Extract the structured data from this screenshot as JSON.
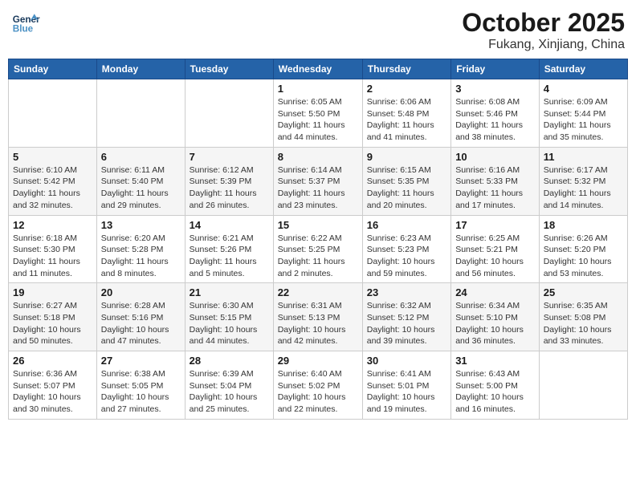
{
  "header": {
    "logo_line1": "General",
    "logo_line2": "Blue",
    "month": "October 2025",
    "location": "Fukang, Xinjiang, China"
  },
  "weekdays": [
    "Sunday",
    "Monday",
    "Tuesday",
    "Wednesday",
    "Thursday",
    "Friday",
    "Saturday"
  ],
  "weeks": [
    [
      {
        "day": "",
        "info": ""
      },
      {
        "day": "",
        "info": ""
      },
      {
        "day": "",
        "info": ""
      },
      {
        "day": "1",
        "info": "Sunrise: 6:05 AM\nSunset: 5:50 PM\nDaylight: 11 hours and 44 minutes."
      },
      {
        "day": "2",
        "info": "Sunrise: 6:06 AM\nSunset: 5:48 PM\nDaylight: 11 hours and 41 minutes."
      },
      {
        "day": "3",
        "info": "Sunrise: 6:08 AM\nSunset: 5:46 PM\nDaylight: 11 hours and 38 minutes."
      },
      {
        "day": "4",
        "info": "Sunrise: 6:09 AM\nSunset: 5:44 PM\nDaylight: 11 hours and 35 minutes."
      }
    ],
    [
      {
        "day": "5",
        "info": "Sunrise: 6:10 AM\nSunset: 5:42 PM\nDaylight: 11 hours and 32 minutes."
      },
      {
        "day": "6",
        "info": "Sunrise: 6:11 AM\nSunset: 5:40 PM\nDaylight: 11 hours and 29 minutes."
      },
      {
        "day": "7",
        "info": "Sunrise: 6:12 AM\nSunset: 5:39 PM\nDaylight: 11 hours and 26 minutes."
      },
      {
        "day": "8",
        "info": "Sunrise: 6:14 AM\nSunset: 5:37 PM\nDaylight: 11 hours and 23 minutes."
      },
      {
        "day": "9",
        "info": "Sunrise: 6:15 AM\nSunset: 5:35 PM\nDaylight: 11 hours and 20 minutes."
      },
      {
        "day": "10",
        "info": "Sunrise: 6:16 AM\nSunset: 5:33 PM\nDaylight: 11 hours and 17 minutes."
      },
      {
        "day": "11",
        "info": "Sunrise: 6:17 AM\nSunset: 5:32 PM\nDaylight: 11 hours and 14 minutes."
      }
    ],
    [
      {
        "day": "12",
        "info": "Sunrise: 6:18 AM\nSunset: 5:30 PM\nDaylight: 11 hours and 11 minutes."
      },
      {
        "day": "13",
        "info": "Sunrise: 6:20 AM\nSunset: 5:28 PM\nDaylight: 11 hours and 8 minutes."
      },
      {
        "day": "14",
        "info": "Sunrise: 6:21 AM\nSunset: 5:26 PM\nDaylight: 11 hours and 5 minutes."
      },
      {
        "day": "15",
        "info": "Sunrise: 6:22 AM\nSunset: 5:25 PM\nDaylight: 11 hours and 2 minutes."
      },
      {
        "day": "16",
        "info": "Sunrise: 6:23 AM\nSunset: 5:23 PM\nDaylight: 10 hours and 59 minutes."
      },
      {
        "day": "17",
        "info": "Sunrise: 6:25 AM\nSunset: 5:21 PM\nDaylight: 10 hours and 56 minutes."
      },
      {
        "day": "18",
        "info": "Sunrise: 6:26 AM\nSunset: 5:20 PM\nDaylight: 10 hours and 53 minutes."
      }
    ],
    [
      {
        "day": "19",
        "info": "Sunrise: 6:27 AM\nSunset: 5:18 PM\nDaylight: 10 hours and 50 minutes."
      },
      {
        "day": "20",
        "info": "Sunrise: 6:28 AM\nSunset: 5:16 PM\nDaylight: 10 hours and 47 minutes."
      },
      {
        "day": "21",
        "info": "Sunrise: 6:30 AM\nSunset: 5:15 PM\nDaylight: 10 hours and 44 minutes."
      },
      {
        "day": "22",
        "info": "Sunrise: 6:31 AM\nSunset: 5:13 PM\nDaylight: 10 hours and 42 minutes."
      },
      {
        "day": "23",
        "info": "Sunrise: 6:32 AM\nSunset: 5:12 PM\nDaylight: 10 hours and 39 minutes."
      },
      {
        "day": "24",
        "info": "Sunrise: 6:34 AM\nSunset: 5:10 PM\nDaylight: 10 hours and 36 minutes."
      },
      {
        "day": "25",
        "info": "Sunrise: 6:35 AM\nSunset: 5:08 PM\nDaylight: 10 hours and 33 minutes."
      }
    ],
    [
      {
        "day": "26",
        "info": "Sunrise: 6:36 AM\nSunset: 5:07 PM\nDaylight: 10 hours and 30 minutes."
      },
      {
        "day": "27",
        "info": "Sunrise: 6:38 AM\nSunset: 5:05 PM\nDaylight: 10 hours and 27 minutes."
      },
      {
        "day": "28",
        "info": "Sunrise: 6:39 AM\nSunset: 5:04 PM\nDaylight: 10 hours and 25 minutes."
      },
      {
        "day": "29",
        "info": "Sunrise: 6:40 AM\nSunset: 5:02 PM\nDaylight: 10 hours and 22 minutes."
      },
      {
        "day": "30",
        "info": "Sunrise: 6:41 AM\nSunset: 5:01 PM\nDaylight: 10 hours and 19 minutes."
      },
      {
        "day": "31",
        "info": "Sunrise: 6:43 AM\nSunset: 5:00 PM\nDaylight: 10 hours and 16 minutes."
      },
      {
        "day": "",
        "info": ""
      }
    ]
  ],
  "colors": {
    "header_bg": "#2563a8",
    "accent": "#4a90c4"
  }
}
